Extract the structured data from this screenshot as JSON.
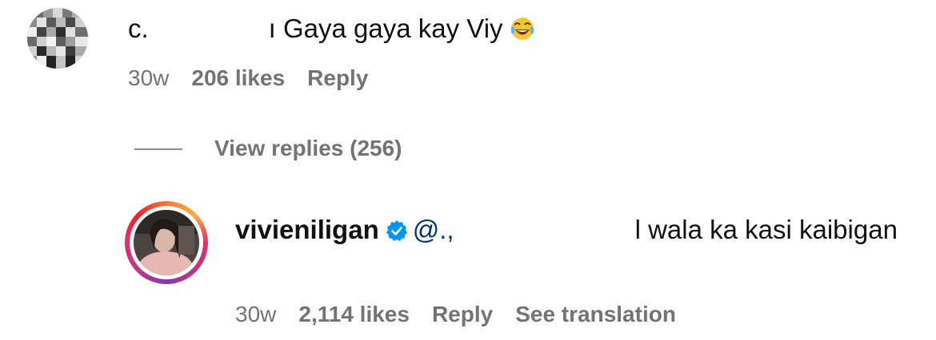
{
  "comment": {
    "username_fragment": "c.",
    "text_fragment": "ı Gaya gaya kay Viy",
    "emoji": "face-with-tears-of-joy",
    "age": "30w",
    "likes": "206 likes",
    "reply_label": "Reply"
  },
  "view_replies": {
    "label": "View replies (256)"
  },
  "reply": {
    "username": "vivieniligan",
    "verified_icon": "verified-badge-icon",
    "mention_fragment": "@.,",
    "text": "l wala ka kasi kaibigan",
    "age": "30w",
    "likes": "2,114 likes",
    "reply_label": "Reply",
    "translate_label": "See translation"
  },
  "colors": {
    "meta_text": "#737373",
    "mention": "#00376b",
    "verified": "#0095f6"
  }
}
